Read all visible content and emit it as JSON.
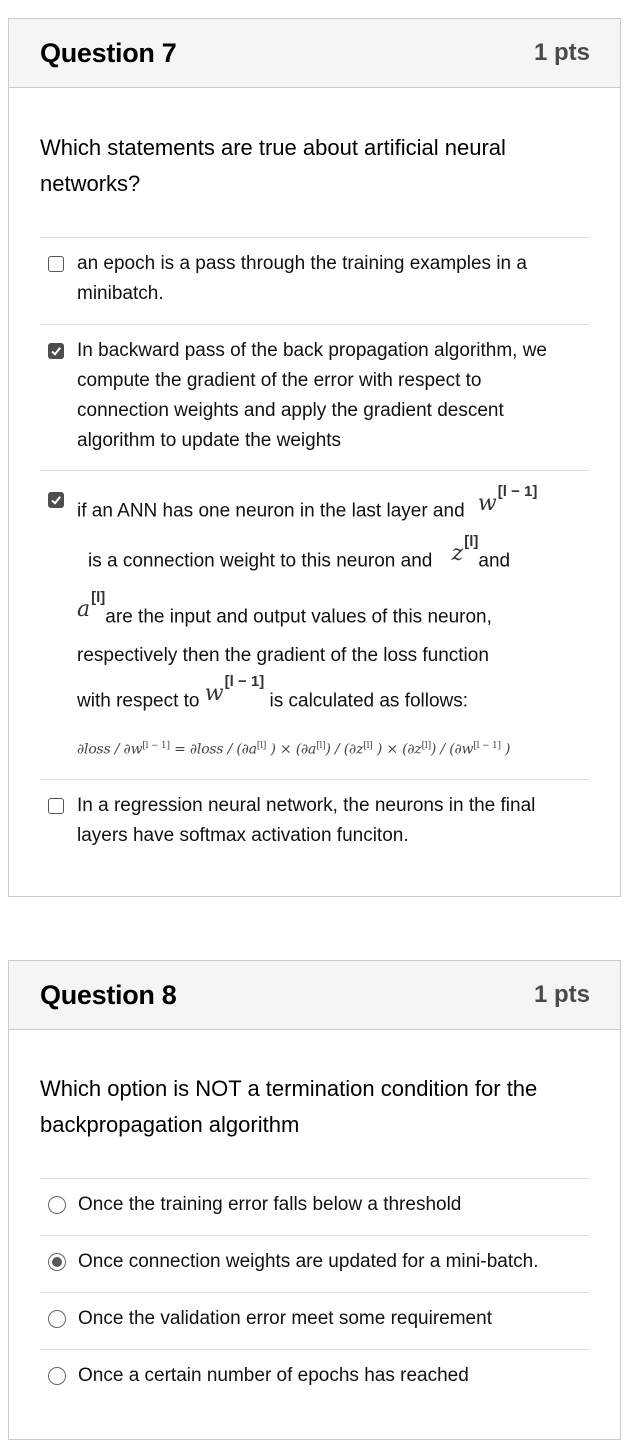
{
  "question7": {
    "title": "Question 7",
    "points": "1 pts",
    "text": "Which statements are  true about artificial neural networks?",
    "answers": [
      {
        "label": "an epoch is a pass through the training examples in a minibatch.",
        "checked": false
      },
      {
        "label": "In backward pass of the back propagation algorithm, we compute the gradient of the error with respect to connection weights and apply the gradient descent algorithm to update the weights",
        "checked": true
      },
      {
        "checked": true,
        "parts": {
          "p1": "if an ANN has one neuron in the last layer and",
          "w_prev": "w",
          "sup_prev": "[l − 1]",
          "p2": "is a connection weight to this neuron and",
          "z": "z",
          "sup_l": "[l]",
          "p3": "and",
          "a": "a",
          "p4": "are the input and output values of this neuron,",
          "p5": "respectively then the  gradient of the loss function",
          "p6": "with respect to",
          "p7": "is calculated as follows:"
        },
        "formula": {
          "lhs": "∂loss / ∂w",
          "lhs_sup": "[l − 1]",
          "eq": " = ∂loss / (∂a",
          "t1_sup": "[l]",
          "t2": " ) × (∂a",
          "t2_sup": "[l]",
          "t3": ") / (∂z",
          "t3_sup": "[l]",
          "t4": " ) × (∂z",
          "t4_sup": "[l]",
          "t5": ") / (∂w",
          "t5_sup": "[l − 1]",
          "t6": " )"
        }
      },
      {
        "label": "In a regression neural network, the neurons in the final layers have softmax activation funciton.",
        "checked": false
      }
    ]
  },
  "question8": {
    "title": "Question 8",
    "points": "1 pts",
    "text": "Which option is NOT a termination condition for the backpropagation algorithm",
    "options": [
      {
        "label": "Once the training error falls below a threshold",
        "selected": false
      },
      {
        "label": "Once connection weights are updated for a mini-batch.",
        "selected": true
      },
      {
        "label": "Once the validation error meet some requirement",
        "selected": false
      },
      {
        "label": "Once a certain number of epochs has reached",
        "selected": false
      }
    ]
  }
}
